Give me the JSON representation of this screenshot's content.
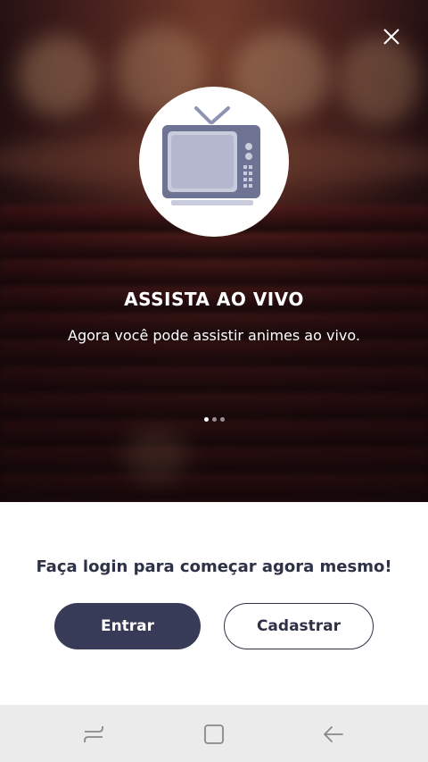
{
  "onboarding": {
    "title": "ASSISTA AO VIVO",
    "subtitle": "Agora você pode assistir animes ao vivo.",
    "pager": {
      "count": 3,
      "active_index": 0
    }
  },
  "auth": {
    "prompt": "Faça login para começar agora mesmo!",
    "login_label": "Entrar",
    "signup_label": "Cadastrar"
  },
  "colors": {
    "primary_button": "#383b57",
    "text_dark": "#2e3247",
    "navbar": "#ebebeb"
  },
  "icons": {
    "close": "close-icon",
    "hero": "tv-icon",
    "nav_recent": "recent-apps-icon",
    "nav_home": "home-icon",
    "nav_back": "back-icon"
  }
}
